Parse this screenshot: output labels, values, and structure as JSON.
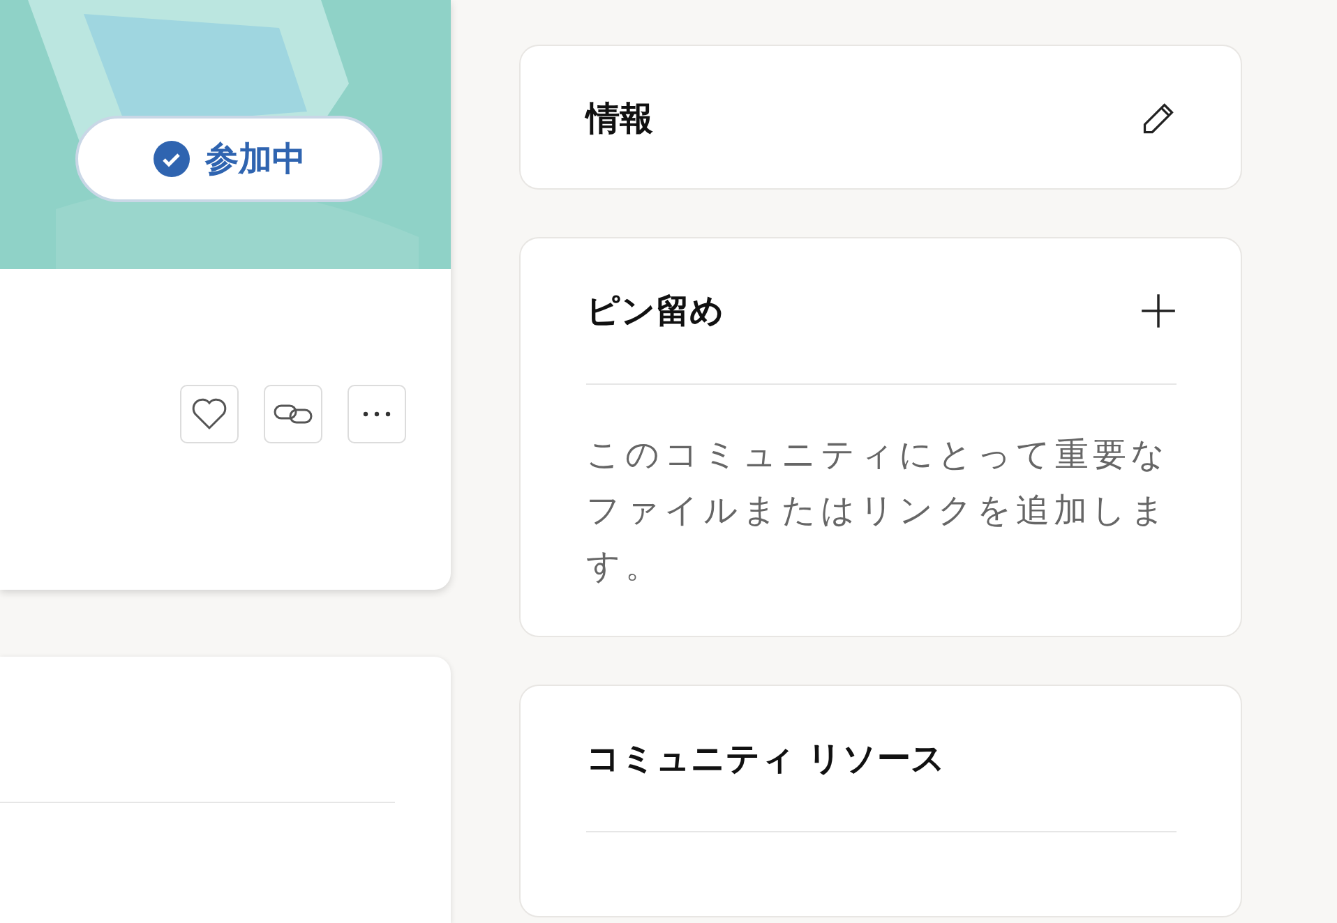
{
  "banner": {
    "join_button": {
      "label": "参加中"
    }
  },
  "sidebar_cards": [
    {
      "kind": "info",
      "title": "情報"
    },
    {
      "kind": "pinned",
      "title": "ピン留め",
      "description": "このコミュニティにとって重要なファイルまたはリンクを追加します。"
    },
    {
      "kind": "resources",
      "title": "コミュニティ リソース"
    }
  ]
}
